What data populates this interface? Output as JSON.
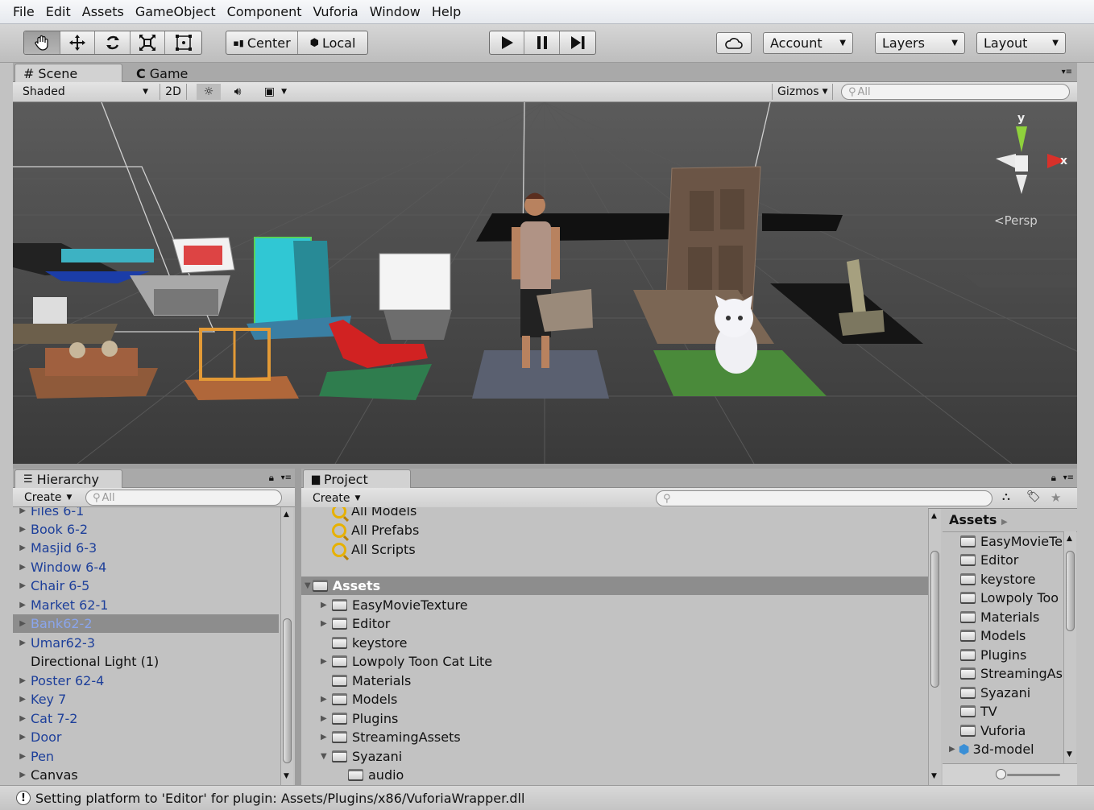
{
  "menu": [
    "File",
    "Edit",
    "Assets",
    "GameObject",
    "Component",
    "Vuforia",
    "Window",
    "Help"
  ],
  "toolbar": {
    "pivot_label": "Center",
    "space_label": "Local",
    "account_label": "Account",
    "layers_label": "Layers",
    "layout_label": "Layout"
  },
  "scene_panel": {
    "tab_scene": "Scene",
    "tab_game": "Game",
    "shading_mode": "Shaded",
    "mode_2d": "2D",
    "gizmos_label": "Gizmos",
    "search_placeholder": "All",
    "axis_y": "y",
    "axis_x": "x",
    "projection": "Persp"
  },
  "hierarchy": {
    "tab_label": "Hierarchy",
    "create_label": "Create",
    "search_placeholder": "All",
    "items": [
      {
        "label": "Files 6-1"
      },
      {
        "label": "Book 6-2"
      },
      {
        "label": "Masjid 6-3"
      },
      {
        "label": "Window 6-4"
      },
      {
        "label": "Chair 6-5"
      },
      {
        "label": "Market 62-1"
      },
      {
        "label": "Bank62-2"
      },
      {
        "label": "Umar62-3"
      },
      {
        "label": "Directional Light (1)"
      },
      {
        "label": "Poster 62-4"
      },
      {
        "label": "Key 7"
      },
      {
        "label": "Cat 7-2"
      },
      {
        "label": "Door"
      },
      {
        "label": "Pen"
      },
      {
        "label": "Canvas"
      }
    ]
  },
  "project": {
    "tab_label": "Project",
    "create_label": "Create",
    "favorites": [
      "All Models",
      "All Prefabs",
      "All Scripts"
    ],
    "root_label": "Assets",
    "tree": [
      {
        "label": "EasyMovieTexture"
      },
      {
        "label": "Editor"
      },
      {
        "label": "keystore"
      },
      {
        "label": "Lowpoly Toon Cat Lite"
      },
      {
        "label": "Materials"
      },
      {
        "label": "Models"
      },
      {
        "label": "Plugins"
      },
      {
        "label": "StreamingAssets"
      },
      {
        "label": "Syazani"
      },
      {
        "label": "audio"
      }
    ],
    "breadcrumb": "Assets",
    "assets": [
      {
        "label": "EasyMovieTe"
      },
      {
        "label": "Editor"
      },
      {
        "label": "keystore"
      },
      {
        "label": "Lowpoly Too"
      },
      {
        "label": "Materials"
      },
      {
        "label": "Models"
      },
      {
        "label": "Plugins"
      },
      {
        "label": "StreamingAs"
      },
      {
        "label": "Syazani"
      },
      {
        "label": "TV"
      },
      {
        "label": "Vuforia"
      },
      {
        "label": "3d-model"
      }
    ]
  },
  "status": {
    "message": "Setting platform to 'Editor' for plugin: Assets/Plugins/x86/VuforiaWrapper.dll"
  },
  "colors": {
    "scene_bg": "#3c3c3c",
    "hierarchy_link": "#1d3f9a",
    "selection": "#8d8d8d",
    "gizmo_y": "#8fd13c",
    "gizmo_x": "#d8312a"
  }
}
